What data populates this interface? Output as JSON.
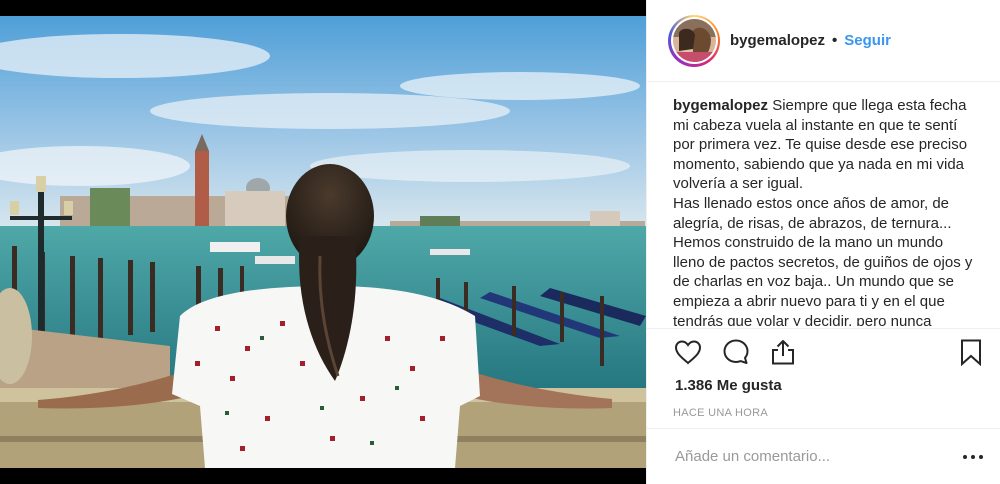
{
  "post": {
    "username": "bygemalopez",
    "separator": "•",
    "follow_label": "Seguir",
    "caption_username": "bygemalopez",
    "caption_lines": [
      "Siempre que llega esta fecha mi cabeza vuela al instante en que te sentí por primera vez. Te quise desde ese preciso momento, sabiendo que ya nada en mi vida volvería a ser igual.",
      "Has llenado estos once años de amor, de alegría, de risas, de abrazos, de ternura... Hemos construido de la mano un mundo lleno de pactos secretos, de guiños de ojos y de charlas en voz baja.. Un mundo que se empieza a abrir nuevo para ti y en el que tendrás que volar y decidir, pero nunca"
    ],
    "likes": "1.386 Me gusta",
    "timestamp": "HACE UNA HORA",
    "comment_placeholder": "Añade un comentario..."
  },
  "icons": {
    "like": "heart-outline-icon",
    "comment": "speech-bubble-icon",
    "share": "share-upload-icon",
    "save": "bookmark-icon",
    "more": "ellipsis-icon"
  },
  "colors": {
    "link_blue": "#3897f0",
    "text": "#262626",
    "muted": "#999999",
    "divider": "#efefef"
  }
}
